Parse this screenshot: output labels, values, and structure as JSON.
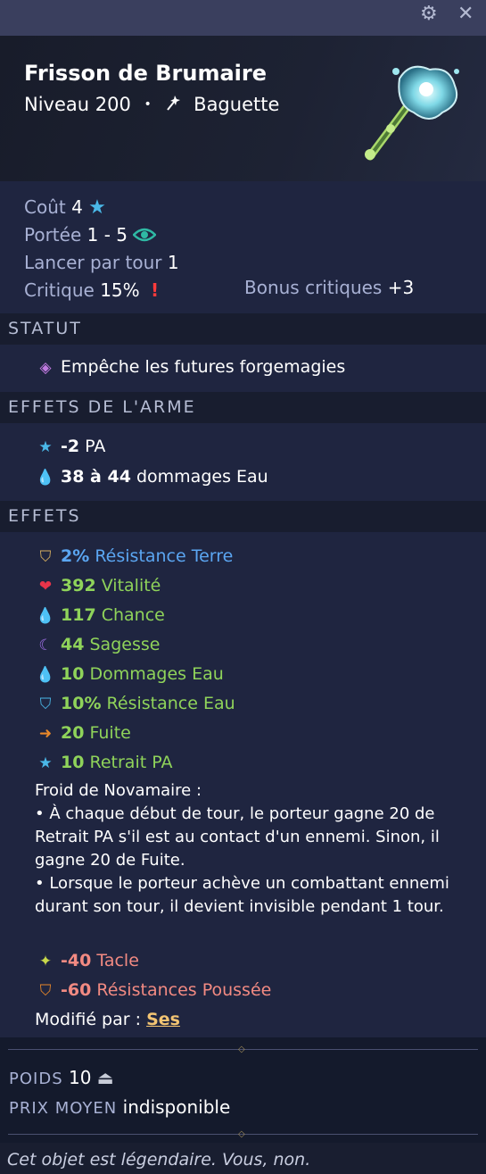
{
  "window": {
    "settings_icon": "gear-icon",
    "close_icon": "close-icon"
  },
  "item": {
    "name": "Frisson de Brumaire",
    "level": "Niveau 200",
    "separator": "•",
    "type": "Baguette",
    "type_icon": "wand-icon"
  },
  "stats": {
    "cost_label": "Coût",
    "cost_value": "4",
    "range_label": "Portée",
    "range_value": "1 - 5",
    "casts_label": "Lancer par tour",
    "casts_value": "1",
    "crit_label": "Critique",
    "crit_value": "15%",
    "crit_bonus_label": "Bonus critiques",
    "crit_bonus_value": "+3"
  },
  "sections": {
    "status": "STATUT",
    "weapon_effects": "EFFETS DE L'ARME",
    "effects": "EFFETS"
  },
  "status": {
    "text": "Empêche les futures forgemagies"
  },
  "weapon_effects": [
    {
      "icon": "star-icon",
      "value": "-2",
      "label": "PA"
    },
    {
      "icon": "water-drop-icon",
      "value": "38 à 44",
      "label": "dommages Eau"
    }
  ],
  "effects": [
    {
      "icon": "earth-shield-icon",
      "value": "2%",
      "label": "Résistance Terre",
      "color": "#5ba6f2"
    },
    {
      "icon": "heart-icon",
      "value": "392",
      "label": "Vitalité",
      "color": "#8fd35a"
    },
    {
      "icon": "water-drop-icon",
      "value": "117",
      "label": "Chance",
      "color": "#8fd35a"
    },
    {
      "icon": "moon-icon",
      "value": "44",
      "label": "Sagesse",
      "color": "#8fd35a"
    },
    {
      "icon": "water-drop-icon",
      "value": "10",
      "label": "Dommages Eau",
      "color": "#8fd35a"
    },
    {
      "icon": "water-shield-icon",
      "value": "10%",
      "label": "Résistance Eau",
      "color": "#8fd35a"
    },
    {
      "icon": "escape-icon",
      "value": "20",
      "label": "Fuite",
      "color": "#8fd35a"
    },
    {
      "icon": "ap-reduction-icon",
      "value": "10",
      "label": "Retrait PA",
      "color": "#8fd35a"
    }
  ],
  "special": {
    "text": "Froid de Novamaire :\n• À chaque début de tour, le porteur gagne 20 de Retrait PA s'il est au contact d'un ennemi. Sinon, il gagne 20 de Fuite.\n• Lorsque le porteur achève un combattant ennemi durant son tour, il devient invisible pendant 1 tour."
  },
  "malus": [
    {
      "icon": "tackle-icon",
      "value": "-40",
      "label": "Tacle",
      "color": "#f28a82"
    },
    {
      "icon": "push-shield-icon",
      "value": "-60",
      "label": "Résistances Poussée",
      "color": "#f28a82"
    }
  ],
  "modified": {
    "label": "Modifié par :",
    "link": "Ses"
  },
  "meta": {
    "weight_label": "POIDS",
    "weight_value": "10",
    "price_label": "PRIX MOYEN",
    "price_value": "indisponible"
  },
  "footer": {
    "flavor": "Cet objet est légendaire. Vous, non."
  },
  "colors": {
    "blue": "#5ba6f2",
    "green": "#8fd35a",
    "red": "#f28a82",
    "link": "#f2c473"
  }
}
